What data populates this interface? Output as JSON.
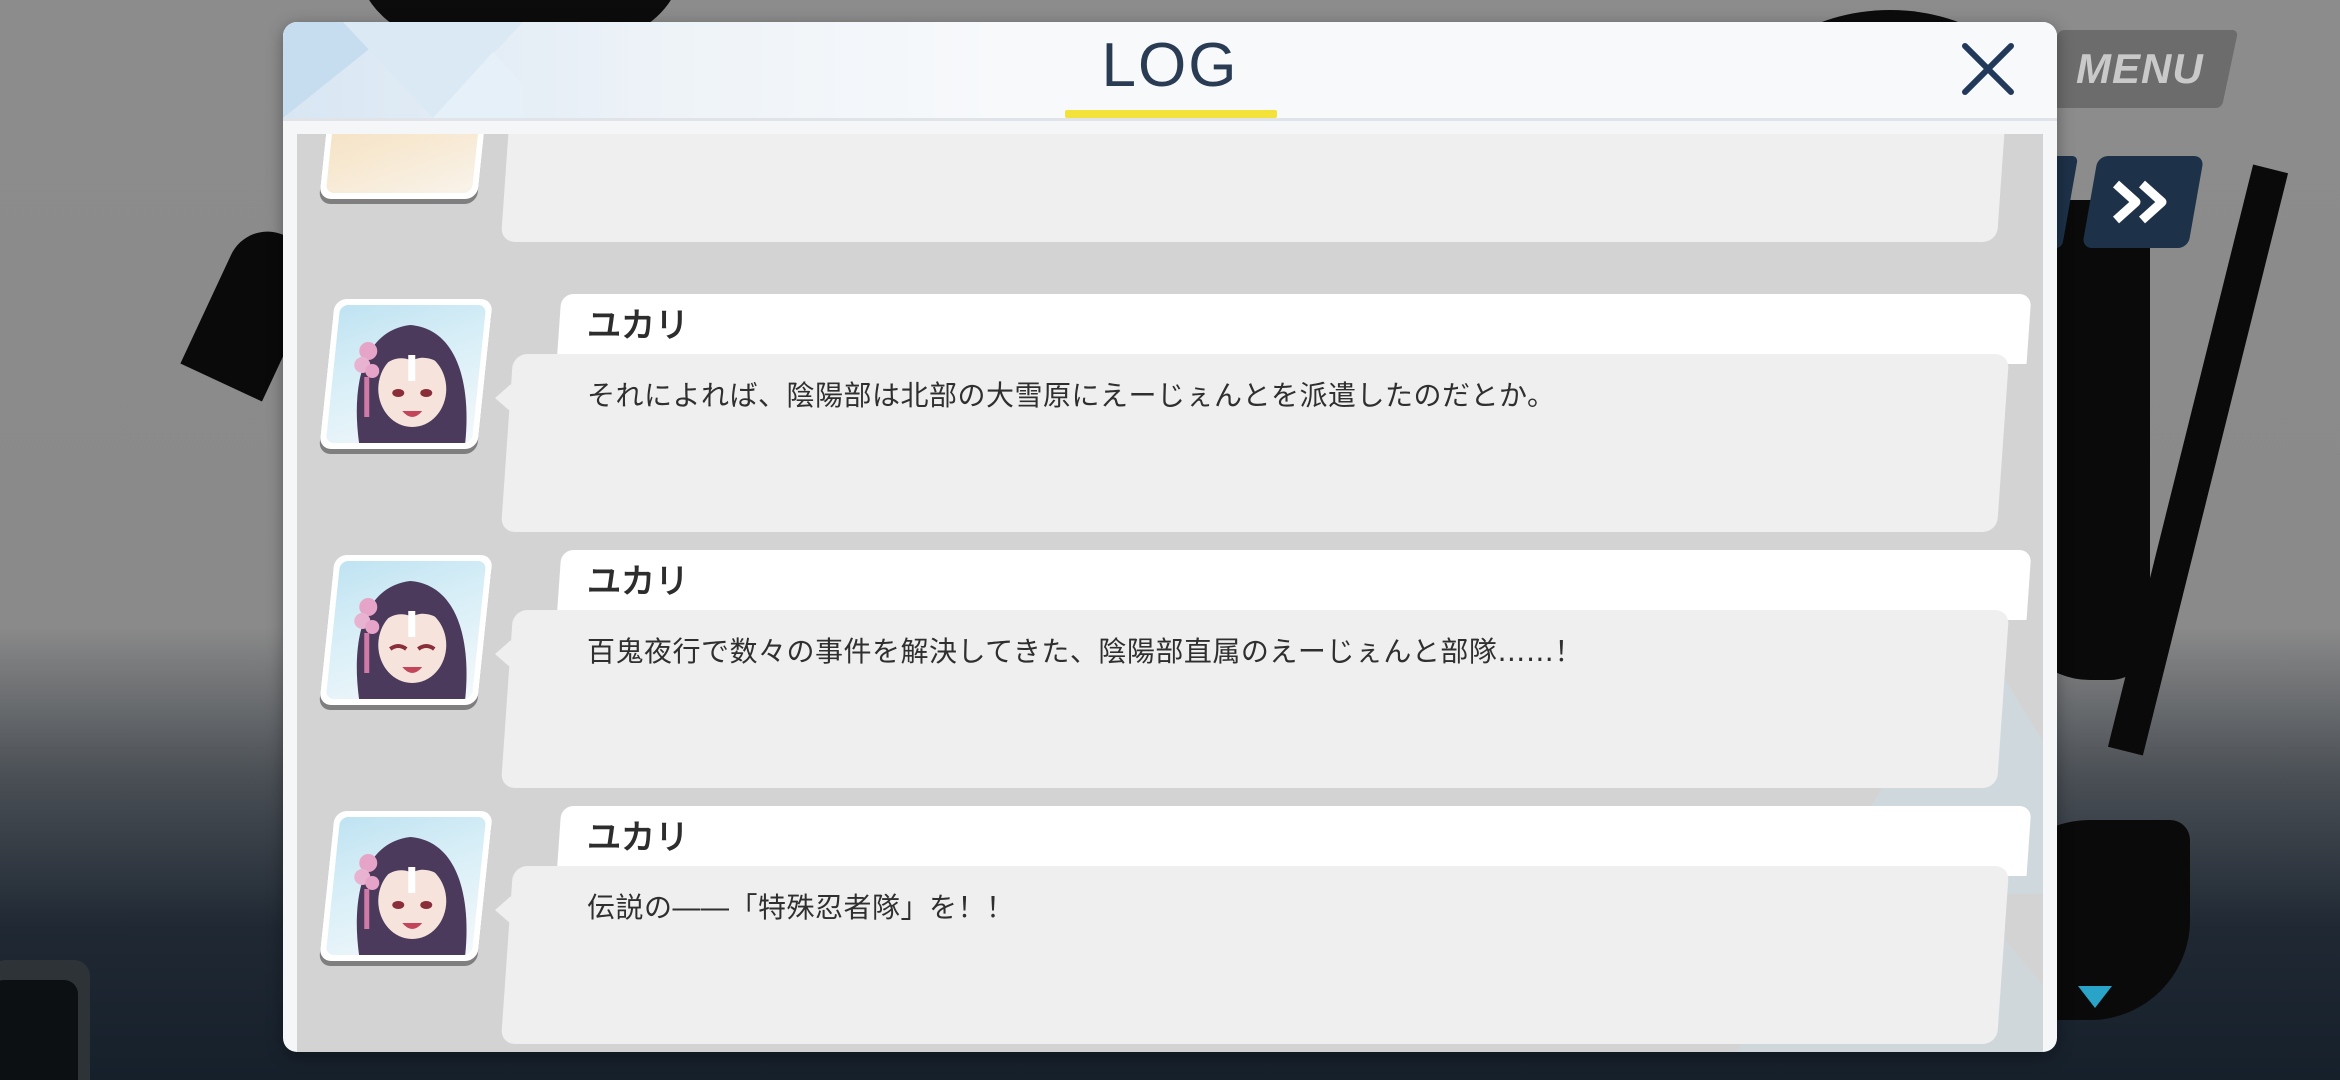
{
  "background": {
    "menu_label": "MENU",
    "skip_icon": "fast-forward-icon",
    "next_icon": "next-arrow-icon"
  },
  "log": {
    "title": "LOG",
    "close_icon": "close-icon",
    "accent_color": "#f2e23a",
    "entries": [
      {
        "speaker": "ユカリ",
        "text": "それによれば、陰陽部は北部の大雪原にえーじぇんとを派遣したのだとか。"
      },
      {
        "speaker": "ユカリ",
        "text": "百鬼夜行で数々の事件を解決してきた、陰陽部直属のえーじぇんと部隊……！"
      },
      {
        "speaker": "ユカリ",
        "text": "伝説の――「特殊忍者隊」を！！"
      }
    ]
  }
}
